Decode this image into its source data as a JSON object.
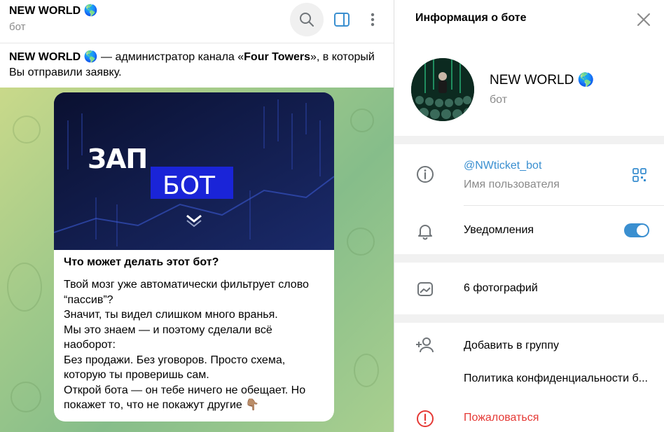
{
  "chat": {
    "title": "NEW WORLD 🌎",
    "subtitle": "бот",
    "notice": {
      "bot_name": "NEW WORLD 🌎",
      "text_before": " — администратор канала «",
      "channel": "Four Towers",
      "text_after": "», в который Вы отправили заявку."
    },
    "message": {
      "media": {
        "word1": "ЗАП",
        "word2": "БОТ"
      },
      "title": "Что может делать этот бот?",
      "lines": [
        "Твой мозг уже автоматически фильтрует слово “пассив”?",
        "Значит, ты видел слишком много вранья.",
        "Мы это знаем — и поэтому сделали всё наоборот:",
        "Без продажи. Без уговоров. Просто схема, которую ты проверишь сам.",
        "Открой бота — он тебе ничего не обещает. Но покажет то, что не покажут другие 👇🏽"
      ]
    }
  },
  "header_icons": {
    "search": "search-icon",
    "sidebar": "sidebar-toggle-icon",
    "more": "more-vertical-icon"
  },
  "info": {
    "title": "Информация о боте",
    "name": "NEW WORLD 🌎",
    "subtitle": "бот",
    "username": "@NWticket_bot",
    "username_caption": "Имя пользователя",
    "notifications": "Уведомления",
    "notifications_on": true,
    "photos": "6 фотографий",
    "add_to_group": "Добавить в группу",
    "privacy": "Политика конфиденциальности б...",
    "report": "Пожаловаться"
  },
  "colors": {
    "accent": "#3a8fd0",
    "danger": "#e53935"
  }
}
